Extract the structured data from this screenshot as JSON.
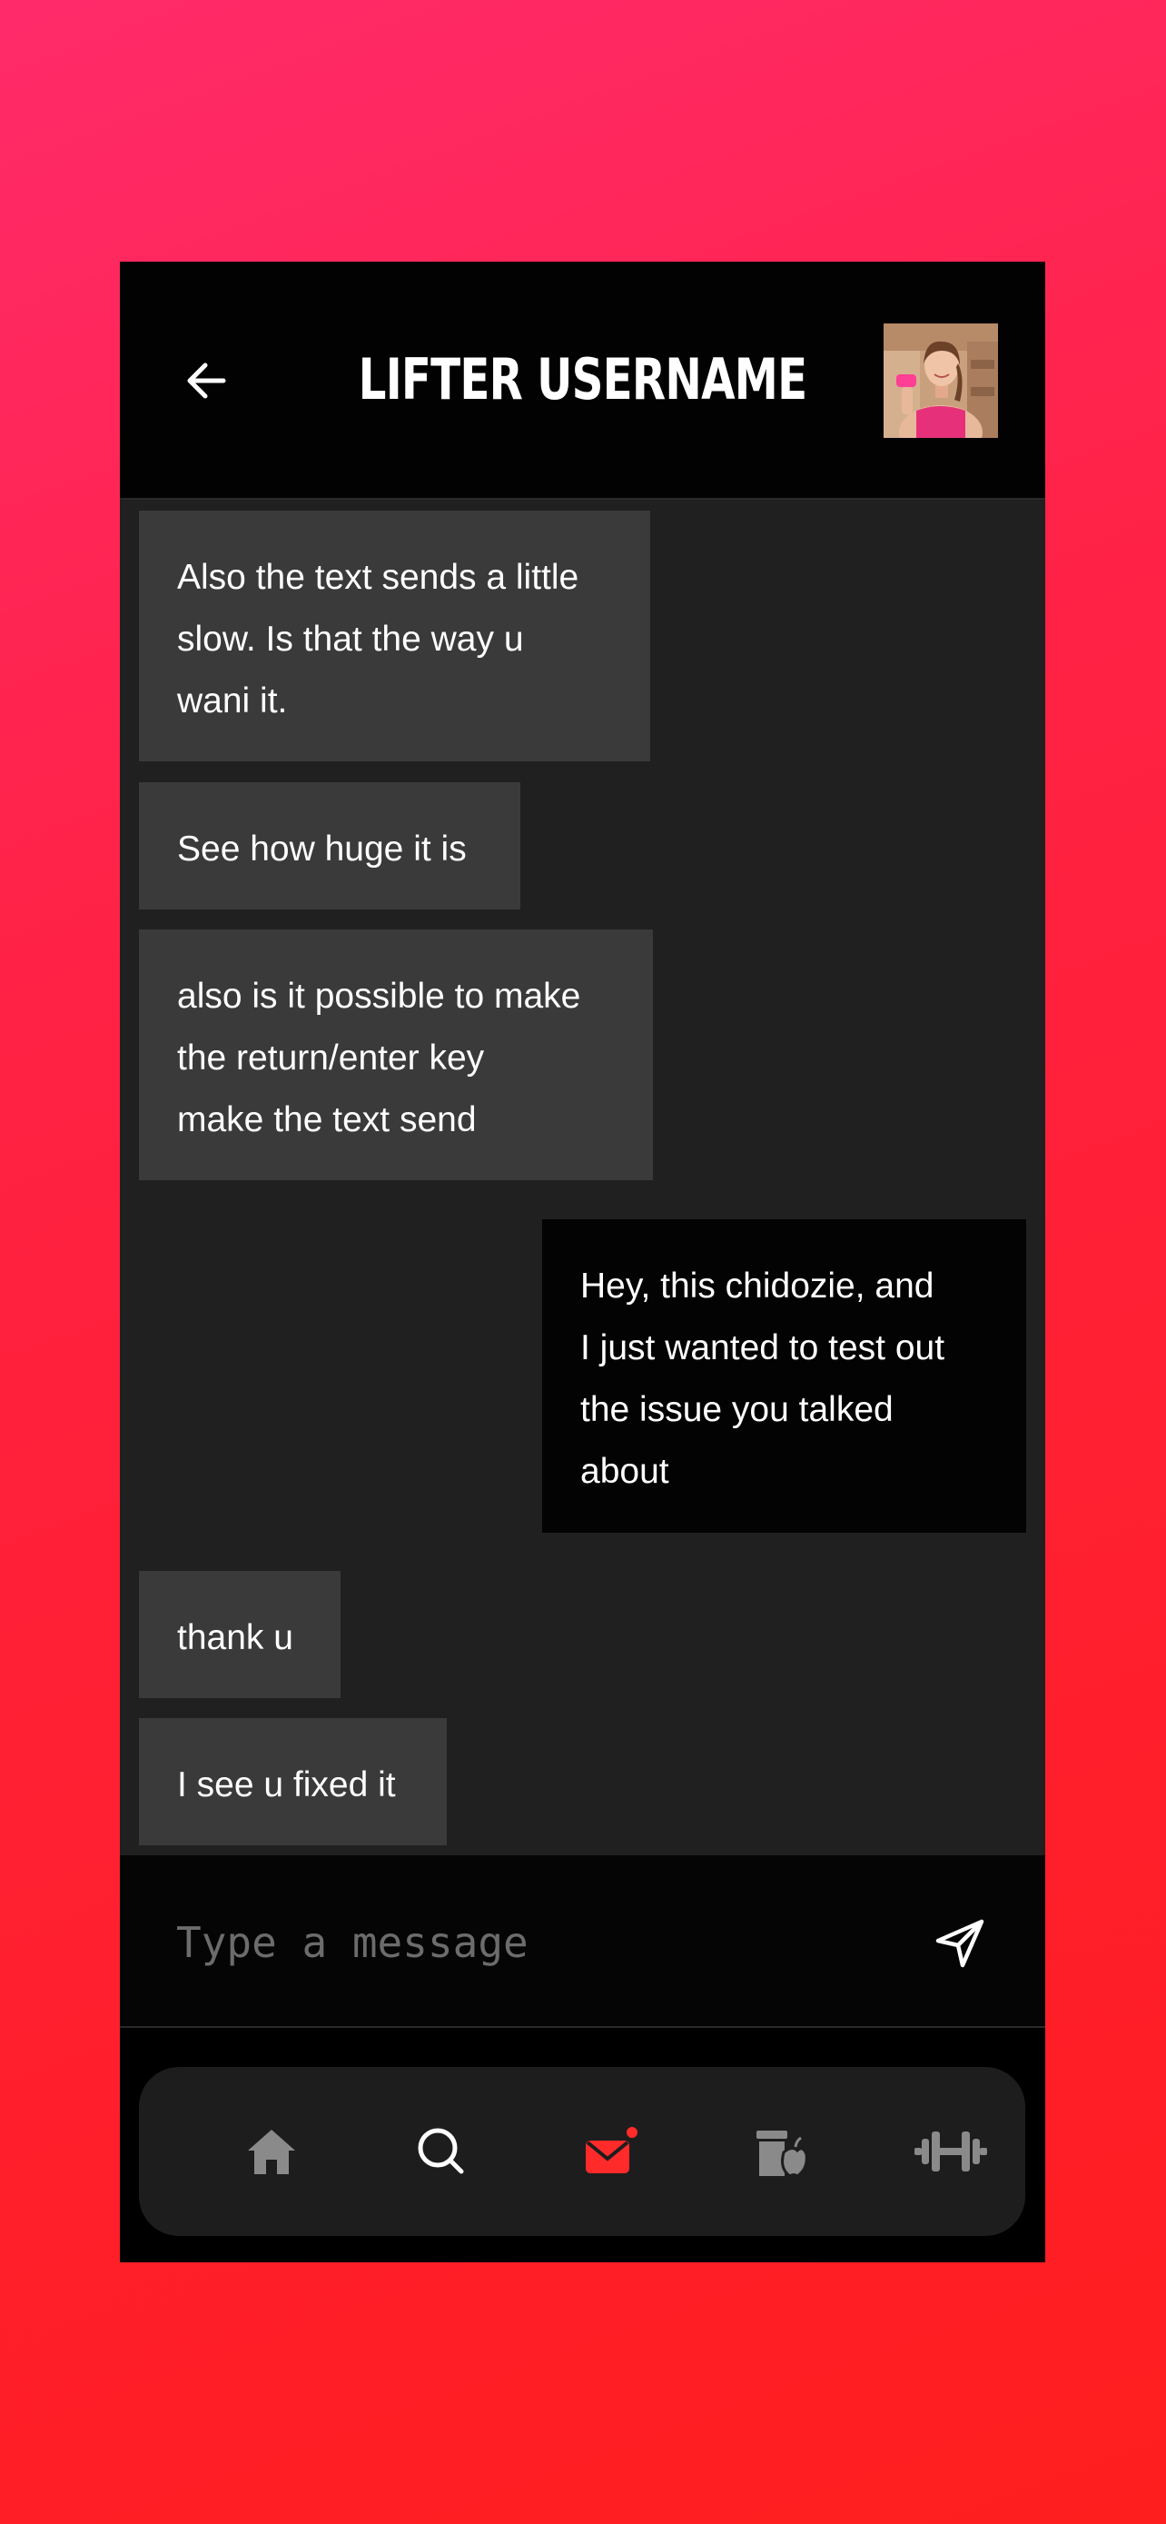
{
  "header": {
    "title": "LIFTER USERNAME",
    "back_icon": "arrow-left-icon",
    "avatar": "profile-photo"
  },
  "messages": [
    {
      "from": "them",
      "text": "Also the text sends a little\nslow. Is that the way u\nwani it."
    },
    {
      "from": "them",
      "text": "See how huge it is"
    },
    {
      "from": "them",
      "text": "also is it possible to make\nthe return/enter key\nmake the text send"
    },
    {
      "from": "me",
      "text": "Hey, this chidozie, and\nI just wanted to test out\nthe issue you talked\nabout"
    },
    {
      "from": "them",
      "text": "thank u"
    },
    {
      "from": "them",
      "text": "I see u fixed it"
    }
  ],
  "composer": {
    "placeholder": "Type a message",
    "value": "",
    "send_icon": "send-icon"
  },
  "tabbar": {
    "active": "messages",
    "active_color": "#ff2a2a",
    "inactive_color": "#8a8a8a",
    "items": [
      {
        "id": "home",
        "icon": "home-icon"
      },
      {
        "id": "search",
        "icon": "search-icon"
      },
      {
        "id": "messages",
        "icon": "mail-icon",
        "has_notification": true
      },
      {
        "id": "nutrition",
        "icon": "nutrition-icon"
      },
      {
        "id": "workouts",
        "icon": "dumbbell-icon"
      }
    ]
  },
  "colors": {
    "background_gradient": [
      "#ff2a6a",
      "#ff1e1e"
    ],
    "incoming_bubble": "#3a3a3a",
    "outgoing_bubble": "#030303",
    "chat_background": "#202020"
  }
}
